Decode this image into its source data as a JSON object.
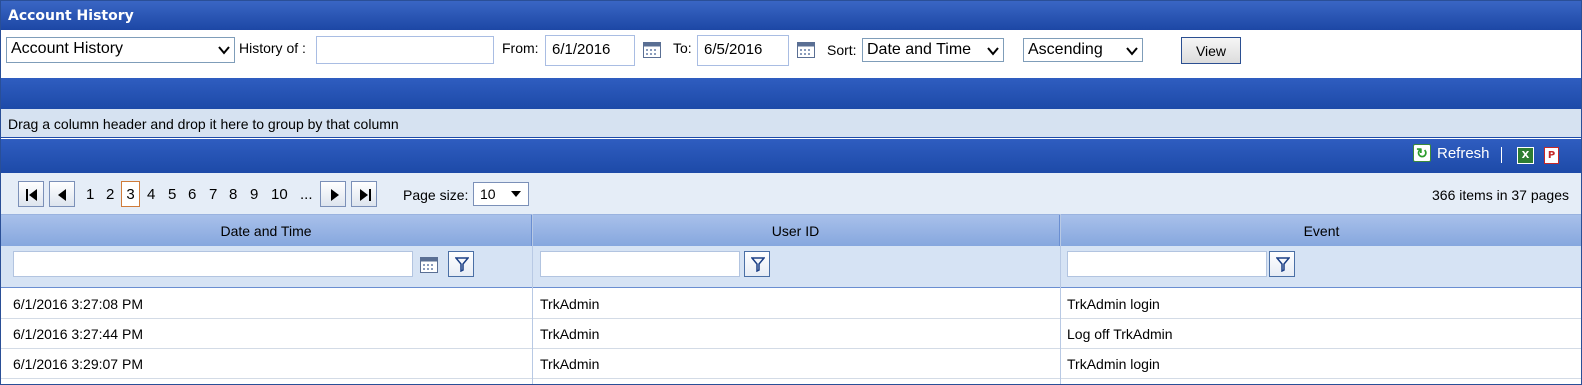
{
  "window": {
    "title": "Account History"
  },
  "filters": {
    "report_type": "Account History",
    "history_of_label": "History of :",
    "history_of_value": "",
    "from_label": "From:",
    "from_value": "6/1/2016",
    "to_label": "To:",
    "to_value": "6/5/2016",
    "sort_label": "Sort:",
    "sort_value": "Date and Time",
    "order_value": "Ascending",
    "view_label": "View"
  },
  "grid": {
    "group_hint": "Drag a column header and drop it here to group by that column",
    "toolbar": {
      "refresh_label": "Refresh",
      "separator": "|"
    },
    "pager": {
      "pages": [
        "1",
        "2",
        "3",
        "4",
        "5",
        "6",
        "7",
        "8",
        "9",
        "10",
        "..."
      ],
      "current_page": "3",
      "page_size_label": "Page size:",
      "page_size": "10",
      "info": "366 items in 37 pages"
    },
    "columns": [
      "Date and Time",
      "User ID",
      "Event"
    ],
    "rows": [
      [
        "6/1/2016 3:27:08 PM",
        "TrkAdmin",
        "TrkAdmin login"
      ],
      [
        "6/1/2016 3:27:44 PM",
        "TrkAdmin",
        "Log off TrkAdmin"
      ],
      [
        "6/1/2016 3:29:07 PM",
        "TrkAdmin",
        "TrkAdmin login"
      ]
    ]
  },
  "colors": {
    "header_blue": "#1d4aa8",
    "column_header": "#86a7de",
    "filter_row": "#d6e3f4"
  }
}
